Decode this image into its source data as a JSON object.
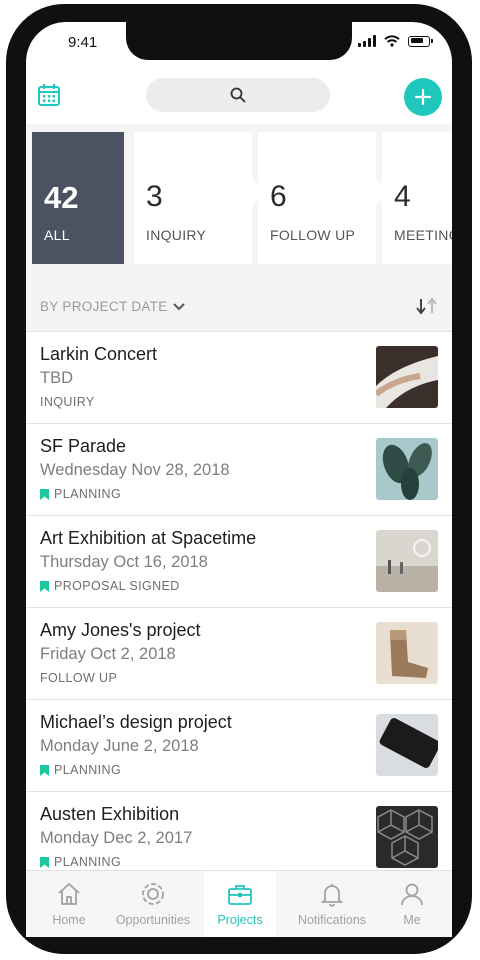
{
  "status_bar": {
    "time": "9:41"
  },
  "topbar": {
    "calendar_icon": "calendar-icon",
    "search_icon": "search-icon",
    "add_icon": "plus-icon",
    "accent": "#1fc7bd"
  },
  "stages": [
    {
      "count": "42",
      "label": "ALL",
      "active": true
    },
    {
      "count": "3",
      "label": "INQUIRY",
      "active": false
    },
    {
      "count": "6",
      "label": "FOLLOW UP",
      "active": false
    },
    {
      "count": "4",
      "label": "MEETING",
      "active": false
    }
  ],
  "sort": {
    "label": "BY PROJECT DATE"
  },
  "projects": [
    {
      "title": "Larkin Concert",
      "date": "TBD",
      "status": "INQUIRY",
      "flagged": false
    },
    {
      "title": "SF Parade",
      "date": "Wednesday Nov 28, 2018",
      "status": "PLANNING",
      "flagged": true
    },
    {
      "title": "Art Exhibition at Spacetime",
      "date": "Thursday Oct 16, 2018",
      "status": "PROPOSAL SIGNED",
      "flagged": true
    },
    {
      "title": "Amy Jones's project",
      "date": "Friday Oct 2, 2018",
      "status": "FOLLOW UP",
      "flagged": false
    },
    {
      "title": "Michael’s design project",
      "date": "Monday June 2, 2018",
      "status": "PLANNING",
      "flagged": true
    },
    {
      "title": "Austen Exhibition",
      "date": "Monday Dec 2, 2017",
      "status": "PLANNING",
      "flagged": true
    }
  ],
  "tabs": [
    {
      "label": "Home",
      "icon": "home-icon"
    },
    {
      "label": "Opportunities",
      "icon": "opportunities-icon"
    },
    {
      "label": "Projects",
      "icon": "briefcase-icon",
      "active": true
    },
    {
      "label": "Notifications",
      "icon": "bell-icon"
    },
    {
      "label": "Me",
      "icon": "user-icon"
    }
  ]
}
